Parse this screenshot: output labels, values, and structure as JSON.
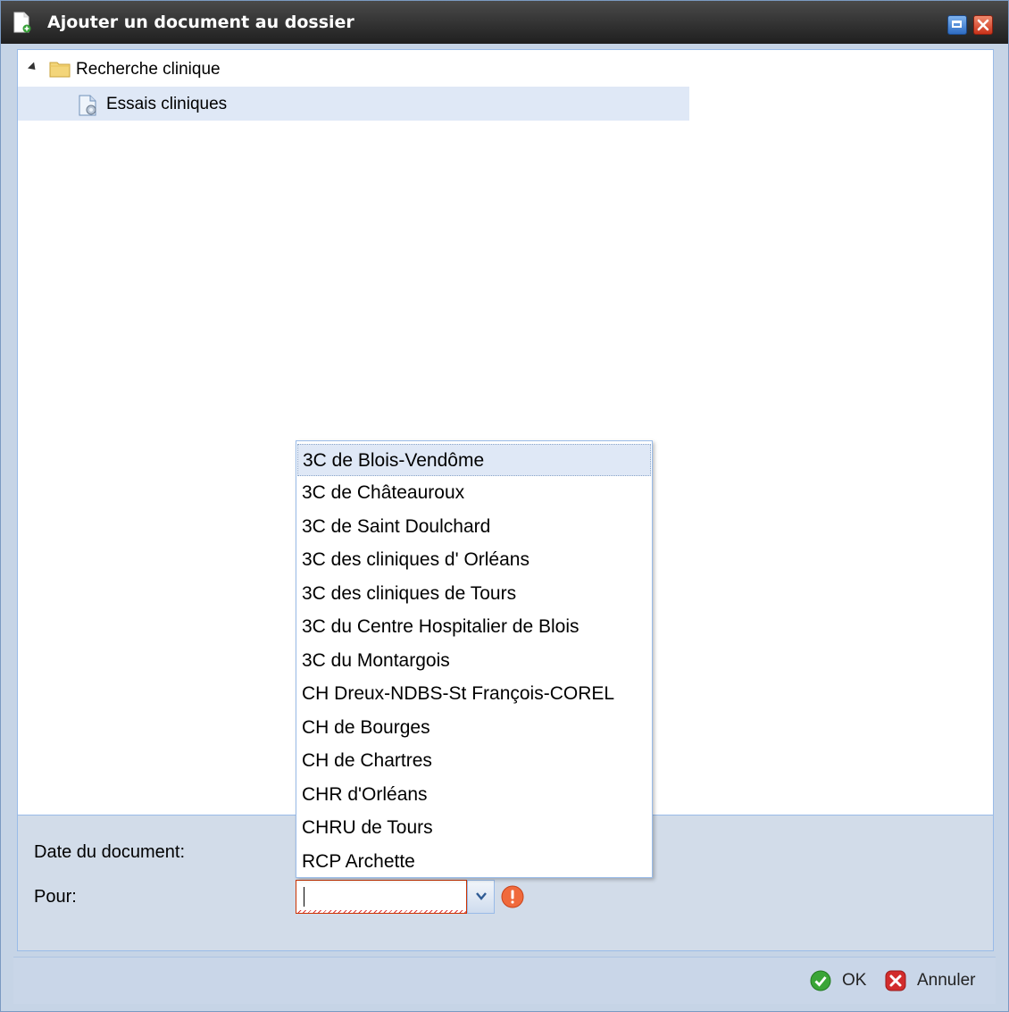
{
  "window": {
    "title": "Ajouter un document au dossier"
  },
  "tree": {
    "root": {
      "label": "Recherche clinique",
      "expanded": true,
      "icon": "folder-icon"
    },
    "children": [
      {
        "label": "Essais cliniques",
        "selected": true,
        "icon": "document-icon"
      }
    ]
  },
  "form": {
    "date_label": "Date du document:",
    "pour_label": "Pour:",
    "pour_value": "",
    "pour_invalid": true
  },
  "dropdown": {
    "items": [
      "3C de Blois-Vendôme",
      "3C de Châteauroux",
      "3C de Saint Doulchard",
      "3C des cliniques d' Orléans",
      "3C des cliniques de Tours",
      "3C du Centre Hospitalier de Blois",
      "3C du Montargois",
      "CH Dreux-NDBS-St François-COREL",
      "CH de Bourges",
      "CH de Chartres",
      "CHR d'Orléans",
      "CHRU de Tours",
      "RCP Archette"
    ],
    "highlighted": "3C de Blois-Vendôme"
  },
  "footer": {
    "ok_label": "OK",
    "cancel_label": "Annuler"
  },
  "colors": {
    "titlebar": "#2b2b2b",
    "panel_border": "#99bbe8",
    "selection": "#dfe8f6",
    "error": "#cc3300",
    "ok_green": "#3aa537",
    "cancel_red": "#d22c2c"
  }
}
